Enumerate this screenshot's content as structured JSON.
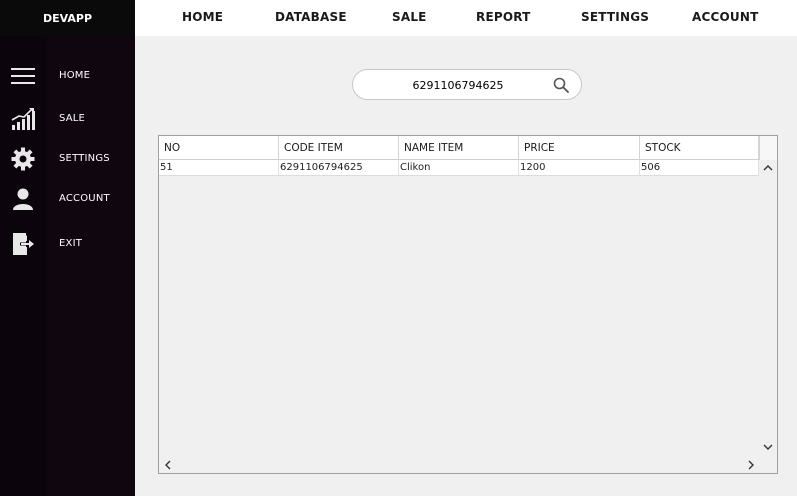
{
  "app": {
    "brand": "DEVAPP"
  },
  "topnav": [
    {
      "label": "HOME"
    },
    {
      "label": "DATABASE"
    },
    {
      "label": "SALE"
    },
    {
      "label": "REPORT"
    },
    {
      "label": "SETTINGS"
    },
    {
      "label": "ACCOUNT"
    }
  ],
  "sidebar": {
    "items": [
      {
        "label": "HOME",
        "icon": "menu-icon"
      },
      {
        "label": "SALE",
        "icon": "chart-icon"
      },
      {
        "label": "SETTINGS",
        "icon": "gear-icon"
      },
      {
        "label": "ACCOUNT",
        "icon": "user-icon"
      },
      {
        "label": "EXIT",
        "icon": "exit-icon"
      }
    ]
  },
  "search": {
    "value": "6291106794625",
    "icon": "search-icon"
  },
  "table": {
    "columns": [
      "NO",
      "CODE ITEM",
      "NAME ITEM",
      "PRICE",
      "STOCK"
    ],
    "rows": [
      [
        "51",
        "6291106794625",
        "Clikon",
        "1200",
        "506"
      ]
    ]
  },
  "colors": {
    "sidebar_bg": "#0f0610",
    "brand_bg": "#0a0a0a",
    "content_bg": "#f0f0f0",
    "topbar_bg": "#ffffff"
  }
}
